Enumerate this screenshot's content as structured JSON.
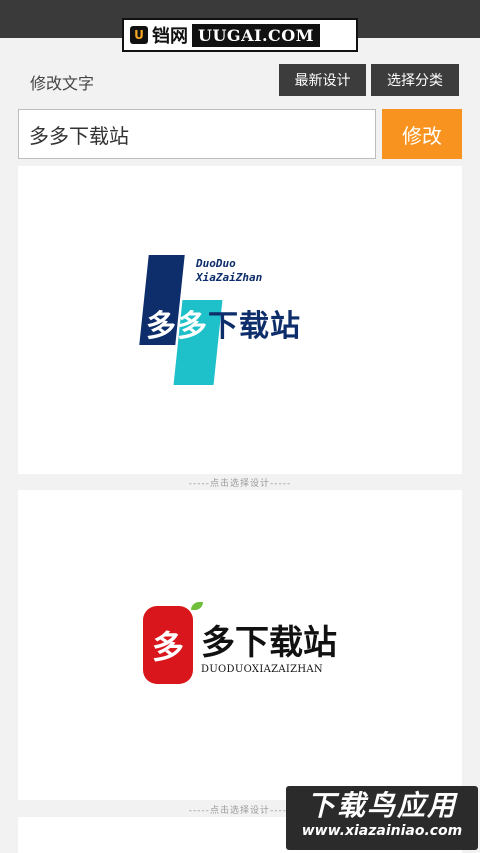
{
  "header": {
    "brand_cn": "铛网",
    "brand_en": "UUGAI.COM"
  },
  "toolbar": {
    "section_label": "修改文字",
    "latest_design_label": "最新设计",
    "choose_category_label": "选择分类"
  },
  "editor": {
    "text_value": "多多下载站",
    "modify_label": "修改"
  },
  "designs": [
    {
      "en_line1": "DuoDuo",
      "en_line2": "XiaZaiZhan",
      "cn_a": "多多",
      "cn_b": "下载站",
      "hint": "-----点击选择设计-----"
    },
    {
      "seal_char": "多",
      "cn": "多下载站",
      "en": "DUODUOXIAZAIZHAN",
      "hint": "-----点击选择设计-----"
    }
  ],
  "watermark": {
    "cn": "下载鸟应用",
    "en": "www.xiazainiao.com"
  },
  "colors": {
    "accent_orange": "#f7931e",
    "dark_button": "#3c3c3c",
    "logo_navy": "#0d2d6b",
    "logo_cyan": "#1ec0c9",
    "seal_red": "#d8161b"
  }
}
